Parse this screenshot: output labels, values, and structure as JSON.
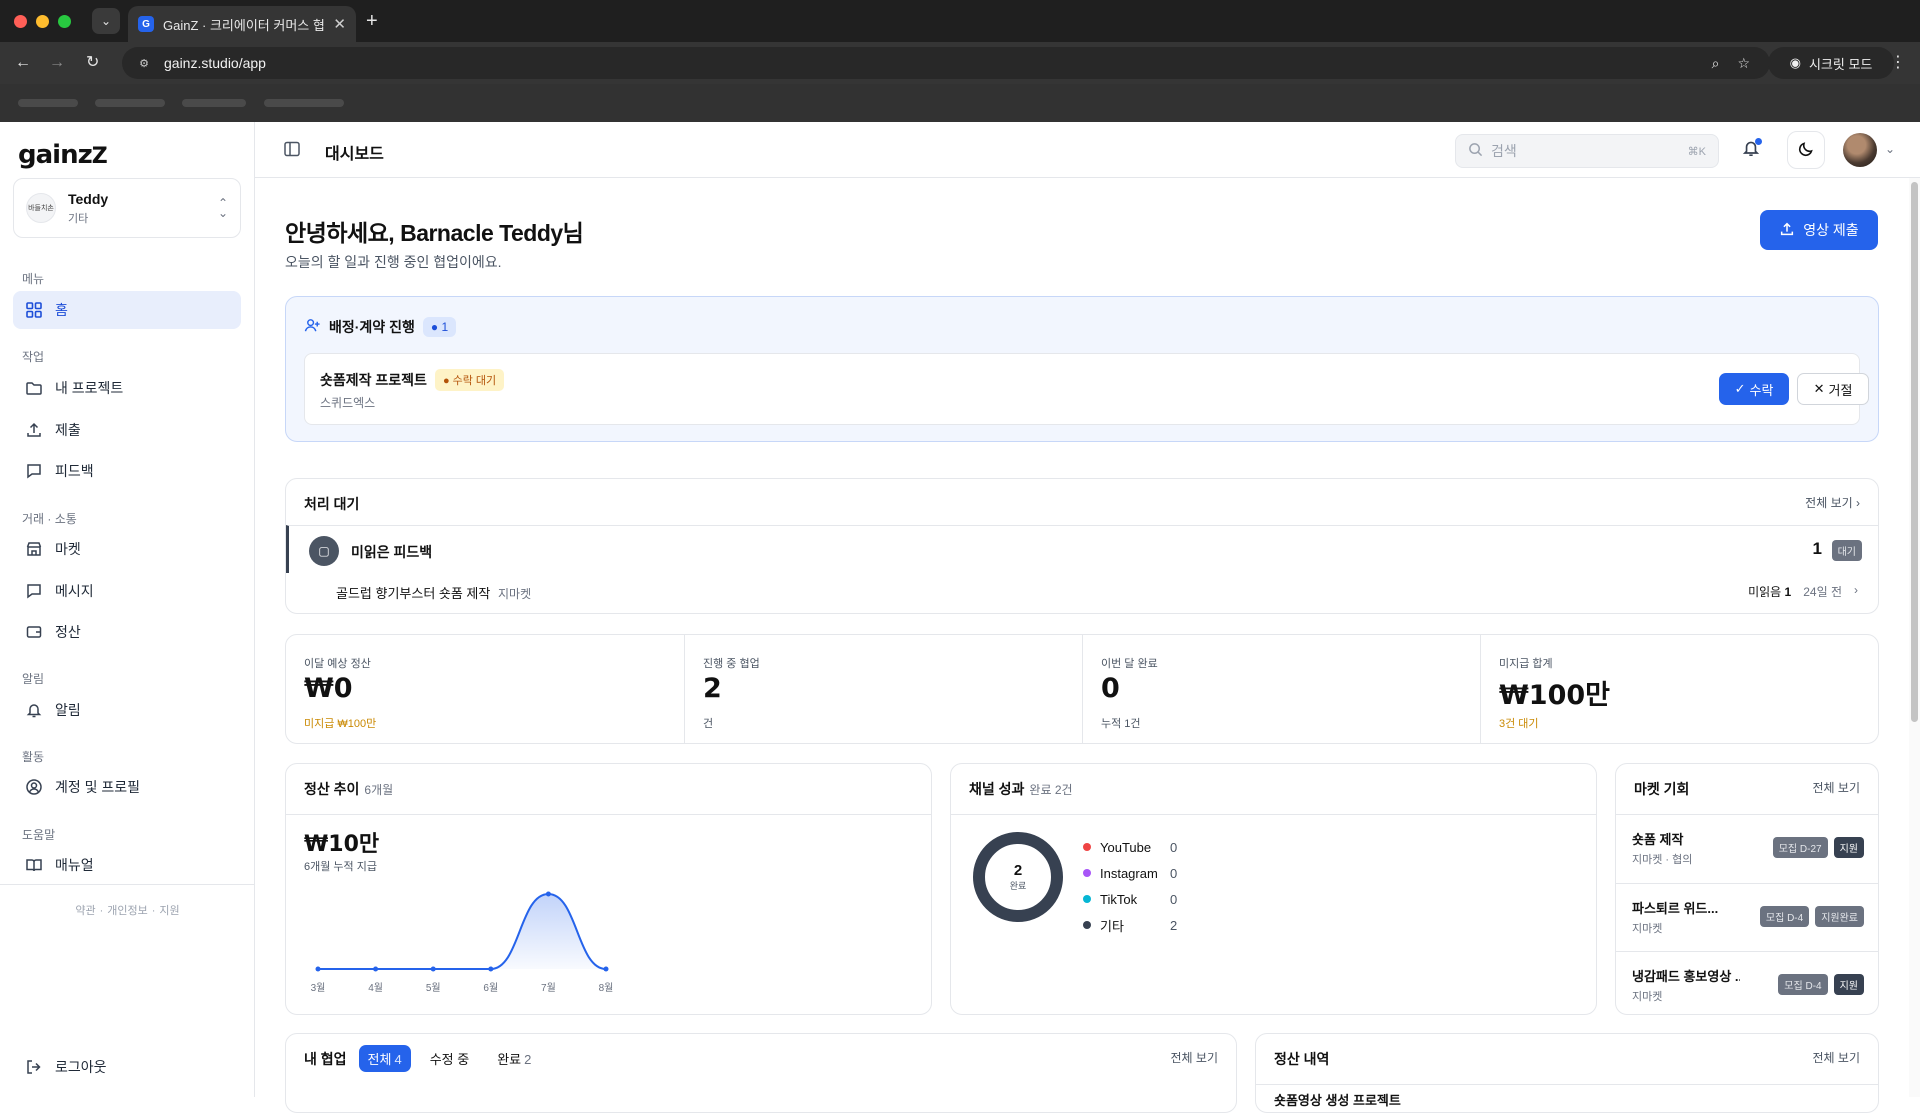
{
  "browser": {
    "tab_title": "GainZ · 크리에이터 커머스 협업 O",
    "favicon_letter": "G",
    "url": "gainz.studio/app",
    "incognito_label": "시크릿 모드"
  },
  "sidebar": {
    "logo": "gainz",
    "workspace": {
      "name": "Teddy",
      "sub": "기타",
      "avatar_text": "바들치손"
    },
    "sections": [
      {
        "label": "메뉴",
        "items": [
          {
            "label": "홈",
            "icon": "home-grid-icon",
            "active": true
          }
        ]
      },
      {
        "label": "작업",
        "items": [
          {
            "label": "내 프로젝트",
            "icon": "folder-icon"
          },
          {
            "label": "제출",
            "icon": "upload-icon"
          },
          {
            "label": "피드백",
            "icon": "chat-icon"
          }
        ]
      },
      {
        "label": "거래 · 소통",
        "items": [
          {
            "label": "마켓",
            "icon": "store-icon"
          },
          {
            "label": "메시지",
            "icon": "message-icon"
          },
          {
            "label": "정산",
            "icon": "wallet-icon"
          }
        ]
      },
      {
        "label": "알림",
        "items": [
          {
            "label": "알림",
            "icon": "bell-icon"
          }
        ]
      },
      {
        "label": "활동",
        "items": [
          {
            "label": "계정 및 프로필",
            "icon": "user-circle-icon"
          }
        ]
      },
      {
        "label": "도움말",
        "items": [
          {
            "label": "매뉴얼",
            "icon": "book-icon"
          }
        ]
      }
    ],
    "footer_links": [
      "약관",
      "개인정보",
      "지원"
    ],
    "logout_label": "로그아웃"
  },
  "header": {
    "title": "대시보드",
    "search_placeholder": "검색",
    "search_shortcut": "⌘K"
  },
  "main": {
    "greeting": "안녕하세요, Barnacle Teddy님",
    "greeting_sub": "오늘의 할 일과 진행 중인 협업이에요.",
    "submit_button": "영상 제출",
    "assignment": {
      "title": "배정·계약 진행",
      "count": "1",
      "item_title": "숏폼제작 프로젝트",
      "item_status": "수락 대기",
      "item_sub": "스퀴드엑스",
      "accept": "수락",
      "reject": "거절"
    },
    "pending": {
      "title": "처리 대기",
      "see_all": "전체 보기",
      "row_label": "미읽은 피드백",
      "row_count": "1",
      "row_badge": "대기",
      "sub_title": "골드럽 향기부스터 숏폼 제작",
      "sub_market": "지마켓",
      "unread_label": "미읽음",
      "unread_count": "1",
      "time_ago": "24일 전"
    },
    "stats": [
      {
        "label": "이달 예상 정산",
        "value": "₩0",
        "sub": "미지급 ₩100만",
        "warn": true
      },
      {
        "label": "진행 중 협업",
        "value": "2",
        "sub": "건",
        "warn": false
      },
      {
        "label": "이번 달 완료",
        "value": "0",
        "sub": "누적 1건",
        "warn": false
      },
      {
        "label": "미지급 합계",
        "value": "₩100만",
        "sub": "3건 대기",
        "warn": true
      }
    ],
    "trend": {
      "title": "정산 추이",
      "period": "6개월",
      "value": "₩10만",
      "sub": "6개월 누적 지급"
    },
    "channel": {
      "title": "채널 성과",
      "sub": "완료 2건",
      "total": "2",
      "total_label": "완료"
    },
    "market": {
      "title": "마켓 기회",
      "see_all": "전체 보기",
      "items": [
        {
          "title": "숏폼 제작",
          "sub": "지마켓 · 협의",
          "badge1": "모집 D-27",
          "badge2": "지원"
        },
        {
          "title": "파스퇴르 위드...",
          "sub": "지마켓",
          "badge1": "모집 D-4",
          "badge2": "지원완료"
        },
        {
          "title": "냉감패드 홍보영상 ...",
          "sub": "지마켓",
          "badge1": "모집 D-4",
          "badge2": "지원"
        }
      ]
    },
    "collab": {
      "title": "내 협업",
      "tabs": [
        {
          "label": "전체",
          "count": "4"
        },
        {
          "label": "수정 중",
          "count": ""
        },
        {
          "label": "완료",
          "count": "2"
        }
      ],
      "see_all": "전체 보기"
    },
    "settlement": {
      "title": "정산 내역",
      "see_all": "전체 보기",
      "first_row": "숏폼영상 생성 프로젝트"
    }
  },
  "chart_data": {
    "type": "area",
    "categories": [
      "3월",
      "4월",
      "5월",
      "6월",
      "7월",
      "8월"
    ],
    "values": [
      0,
      0,
      0,
      0,
      10,
      0
    ],
    "ylabel": "만원",
    "color": "#2563eb"
  },
  "channel_chart": {
    "type": "pie",
    "series": [
      {
        "name": "YouTube",
        "value": 0,
        "color": "#ef4444"
      },
      {
        "name": "Instagram",
        "value": 0,
        "color": "#a855f7"
      },
      {
        "name": "TikTok",
        "value": 0,
        "color": "#06b6d4"
      },
      {
        "name": "기타",
        "value": 2,
        "color": "#374151"
      }
    ]
  },
  "colors": {
    "accent": "#2563eb",
    "warn": "#ca8a04"
  }
}
